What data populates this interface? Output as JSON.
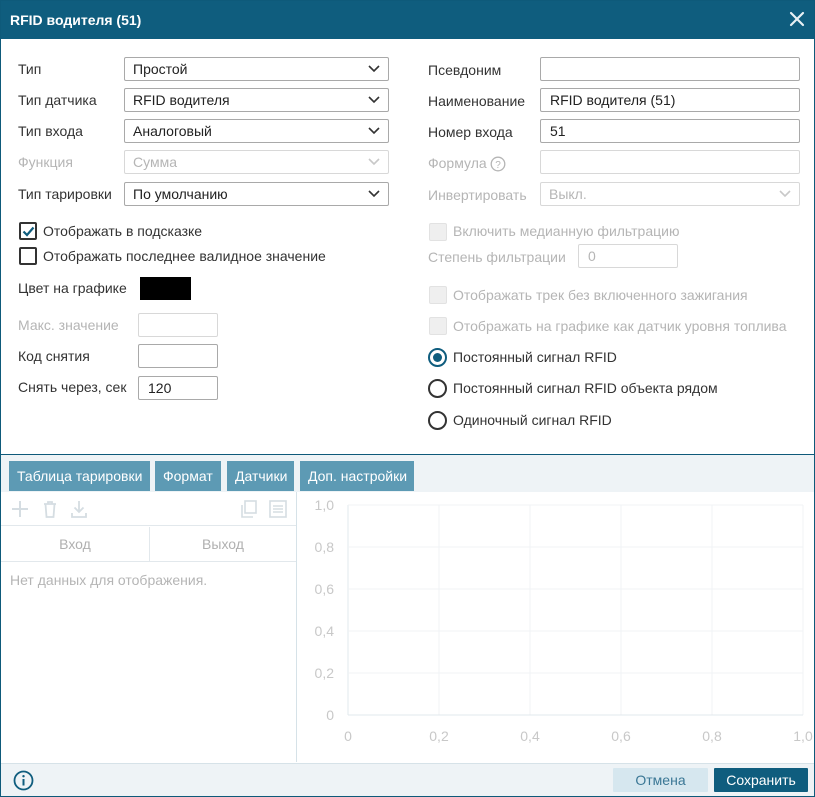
{
  "title": "RFID водителя (51)",
  "left": {
    "type_label": "Тип",
    "type_value": "Простой",
    "sensor_type_label": "Тип датчика",
    "sensor_type_value": "RFID водителя",
    "input_type_label": "Тип входа",
    "input_type_value": "Аналоговый",
    "function_label": "Функция",
    "function_value": "Сумма",
    "calib_type_label": "Тип тарировки",
    "calib_type_value": "По умолчанию",
    "show_in_tooltip": "Отображать в подсказке",
    "show_in_tooltip_checked": true,
    "show_last_valid": "Отображать последнее валидное значение",
    "show_last_valid_checked": false,
    "chart_color_label": "Цвет на графике",
    "chart_color": "#000000",
    "max_value_label": "Макс. значение",
    "max_value": "",
    "reset_code_label": "Код снятия",
    "reset_code": "",
    "reset_after_label": "Снять через, сек",
    "reset_after": "120"
  },
  "right": {
    "alias_label": "Псевдоним",
    "alias_value": "",
    "name_label": "Наименование",
    "name_value": "RFID водителя (51)",
    "input_no_label": "Номер входа",
    "input_no_value": "51",
    "formula_label": "Формула",
    "formula_value": "",
    "invert_label": "Инвертировать",
    "invert_value": "Выкл.",
    "median_filter": "Включить медианную фильтрацию",
    "filter_degree_label": "Степень фильтрации",
    "filter_degree_value": "0",
    "track_no_ignition": "Отображать трек без включенного зажигания",
    "fuel_level_chart": "Отображать на графике как датчик уровня топлива",
    "radio_options": [
      {
        "label": "Постоянный сигнал RFID",
        "selected": true
      },
      {
        "label": "Постоянный сигнал RFID объекта рядом",
        "selected": false
      },
      {
        "label": "Одиночный сигнал RFID",
        "selected": false
      }
    ]
  },
  "tabs": [
    {
      "label": "Таблица тарировки",
      "active": true
    },
    {
      "label": "Формат",
      "active": false
    },
    {
      "label": "Датчики",
      "active": false
    },
    {
      "label": "Доп. настройки",
      "active": false
    }
  ],
  "table": {
    "col_in": "Вход",
    "col_out": "Выход",
    "empty": "Нет данных для отображения."
  },
  "chart_data": {
    "type": "line",
    "x_ticks": [
      "0",
      "0,2",
      "0,4",
      "0,6",
      "0,8",
      "1,0"
    ],
    "y_ticks": [
      "0",
      "0,2",
      "0,4",
      "0,6",
      "0,8",
      "1,0"
    ],
    "xlim": [
      0,
      1
    ],
    "ylim": [
      0,
      1
    ],
    "grid": true,
    "series": []
  },
  "footer": {
    "cancel": "Отмена",
    "save": "Сохранить"
  },
  "colors": {
    "accent": "#0f5d7e",
    "tab": "#5d9ab4"
  }
}
